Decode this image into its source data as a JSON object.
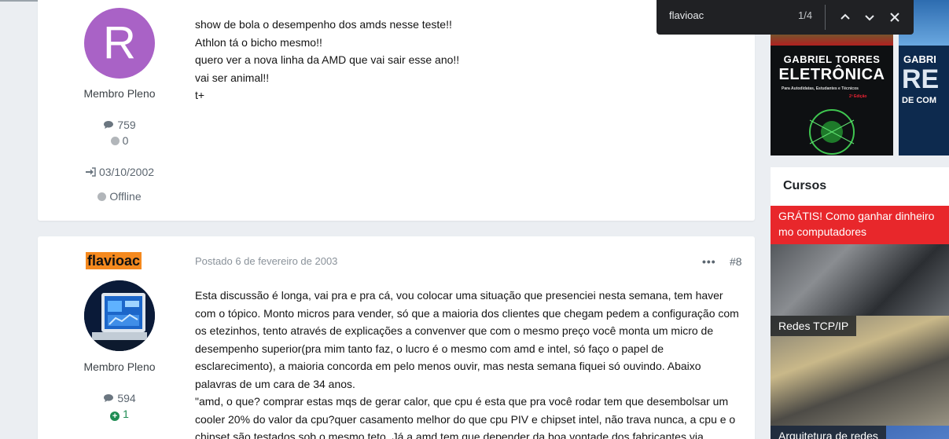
{
  "post1": {
    "avatar_letter": "R",
    "rank": "Membro Pleno",
    "posts_count": "759",
    "reputation": "0",
    "joined": "03/10/2002",
    "status": "Offline",
    "lines": [
      "show de bola o desempenho dos amds nesse teste!!",
      "Athlon tá o bicho mesmo!!",
      "quero ver a nova linha da AMD que vai sair esse ano!!",
      "vai ser animal!!",
      "t+"
    ]
  },
  "post2": {
    "username": "flavioac",
    "rank": "Membro Pleno",
    "posts_count": "594",
    "reputation": "1",
    "posted": "Postado 6 de fevereiro de 2003",
    "more": "•••",
    "number": "#8",
    "lines": [
      "Esta discussão é longa, vai pra e pra cá, vou colocar uma situação que presenciei nesta semana, tem haver",
      "com o tópico. Monto micros para vender, só que a maioria dos clientes que chegam pedem a configuração com",
      "os etezinhos, tento através de explicações a convenver que com o mesmo preço você monta um micro de",
      "desempenho superior(pra mim tanto faz, o lucro é o mesmo com amd e intel, só faço o papel de",
      "esclarecimento), a maioria concorda em pelo menos ouvir, mas nesta semana fiquei só ouvindo. Abaixo",
      "palavras de um cara de 34 anos.",
      "\"amd, o que? comprar estas mqs de gerar calor, que cpu é esta que pra você rodar tem que desembolsar um",
      "cooler 20% do valor da cpu?quer casamento melhor do que cpu PIV e chipset intel, não trava nunca, a cpu e o",
      "chipset são testados sob o mesmo teto. Já a amd tem que depender da boa vontade dos fabricantes via"
    ]
  },
  "books": {
    "book1": {
      "author": "GABRIEL TORRES",
      "title": "ELETRÔNICA",
      "subtitle": "Para Autodidatas, Estudantes e Técnicos",
      "edition": "2ª Edição"
    },
    "book2": {
      "author": "GABRI",
      "title": "RE",
      "subtitle": "DE COM"
    }
  },
  "courses": {
    "title": "Cursos",
    "items": [
      "GRÁTIS! Como ganhar dinheiro mo computadores",
      "Redes TCP/IP",
      "Arquitetura de redes"
    ]
  },
  "findbar": {
    "query": "flavioac",
    "count": "1/4"
  }
}
